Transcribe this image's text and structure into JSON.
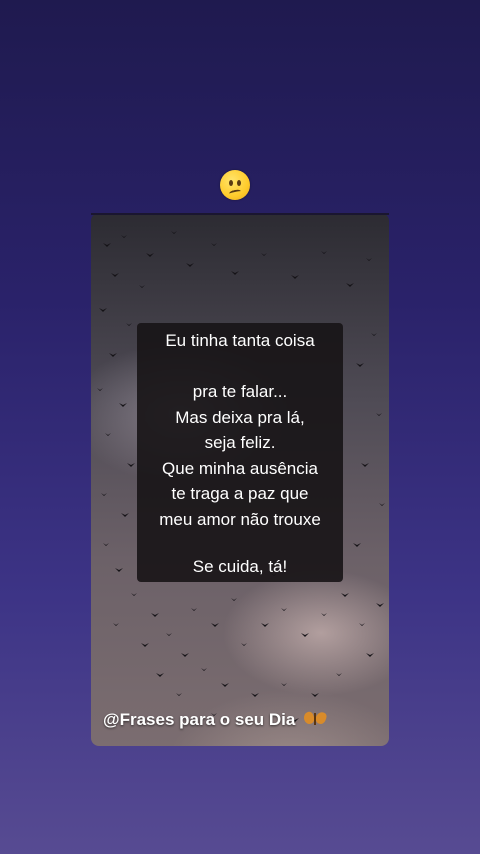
{
  "status_emoji": "confused-face",
  "quote": {
    "lines": [
      "Eu tinha tanta coisa",
      "",
      "pra te falar...",
      "Mas deixa pra lá,",
      "seja feliz.",
      "Que minha ausência",
      "te traga a paz que",
      "meu amor não trouxe",
      "",
      "Se cuida, tá!"
    ]
  },
  "footer": {
    "text": "@Frases para o seu Dia",
    "icon": "butterfly-icon"
  },
  "colors": {
    "bg_top": "#1f1a4f",
    "bg_bottom": "#574b92",
    "quote_bg": "#171416",
    "text": "#ffffff"
  }
}
